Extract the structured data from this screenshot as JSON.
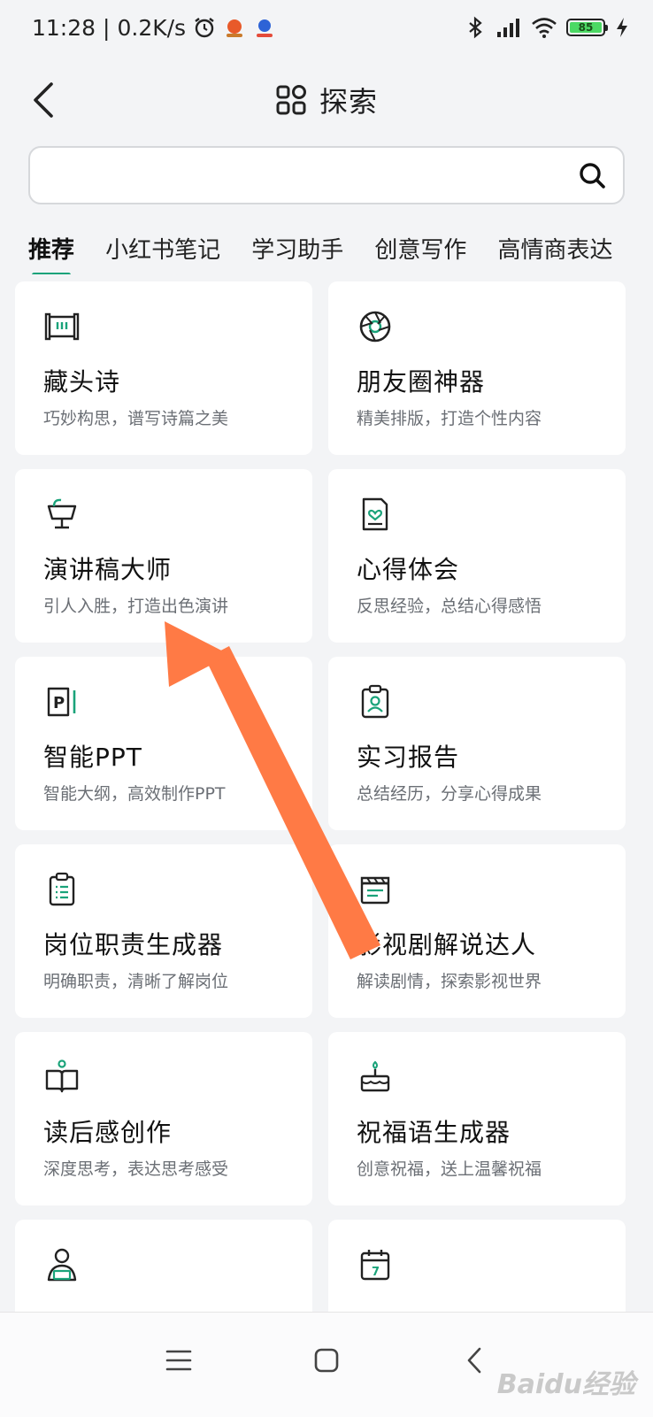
{
  "status_bar": {
    "time": "11:28",
    "network_speed": "0.2K/s",
    "battery_level": "85"
  },
  "header": {
    "title": "探索"
  },
  "search": {
    "value": "",
    "placeholder": ""
  },
  "tabs": [
    {
      "label": "推荐",
      "active": true
    },
    {
      "label": "小红书笔记",
      "active": false
    },
    {
      "label": "学习助手",
      "active": false
    },
    {
      "label": "创意写作",
      "active": false
    },
    {
      "label": "高情商表达",
      "active": false
    }
  ],
  "cards": [
    {
      "title": "藏头诗",
      "desc": "巧妙构思，谱写诗篇之美",
      "icon": "scroll-icon"
    },
    {
      "title": "朋友圈神器",
      "desc": "精美排版，打造个性内容",
      "icon": "aperture-icon"
    },
    {
      "title": "演讲稿大师",
      "desc": "引人入胜，打造出色演讲",
      "icon": "podium-icon"
    },
    {
      "title": "心得体会",
      "desc": "反思经验，总结心得感悟",
      "icon": "heart-document-icon"
    },
    {
      "title": "智能PPT",
      "desc": "智能大纲，高效制作PPT",
      "icon": "ppt-icon"
    },
    {
      "title": "实习报告",
      "desc": "总结经历，分享心得成果",
      "icon": "clipboard-person-icon"
    },
    {
      "title": "岗位职责生成器",
      "desc": "明确职责，清晰了解岗位",
      "icon": "clipboard-list-icon"
    },
    {
      "title": "影视剧解说达人",
      "desc": "解读剧情，探索影视世界",
      "icon": "clapperboard-icon"
    },
    {
      "title": "读后感创作",
      "desc": "深度思考，表达思考感受",
      "icon": "open-book-icon"
    },
    {
      "title": "祝福语生成器",
      "desc": "创意祝福，送上温馨祝福",
      "icon": "cake-icon"
    },
    {
      "title": "",
      "desc": "",
      "icon": "person-laptop-icon"
    },
    {
      "title": "",
      "desc": "",
      "icon": "calendar-icon"
    }
  ],
  "calendar_day": "7",
  "ppt_letter": "P",
  "watermark": "Baidu经验",
  "colors": {
    "accent": "#1aa37a",
    "annotation_arrow": "#ff7a45",
    "background": "#f3f4f6"
  }
}
